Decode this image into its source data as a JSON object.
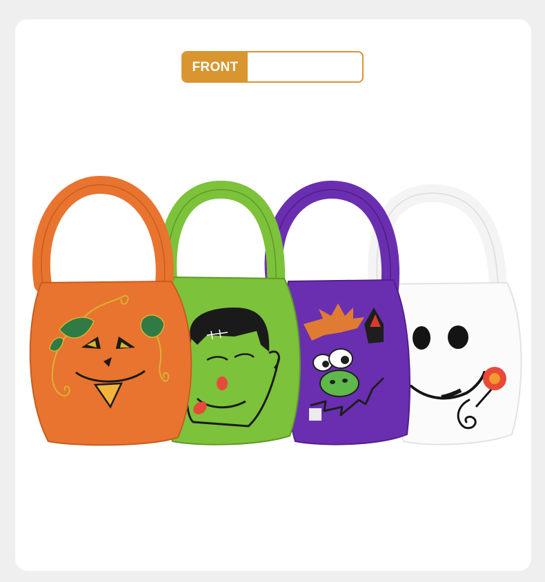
{
  "label": {
    "tag": "FRONT"
  },
  "colors": {
    "background": "#efefef",
    "card": "#ffffff",
    "accent": "#d9952f",
    "pumpkin_bag": "#e8742f",
    "monster_bag": "#7cc23a",
    "purple_bag": "#6a2fb0",
    "ghost_bag": "#fbfbfb"
  },
  "products": [
    {
      "name": "pumpkin-bag"
    },
    {
      "name": "frankenstein-bag"
    },
    {
      "name": "purple-monster-bag"
    },
    {
      "name": "ghost-bag"
    }
  ]
}
